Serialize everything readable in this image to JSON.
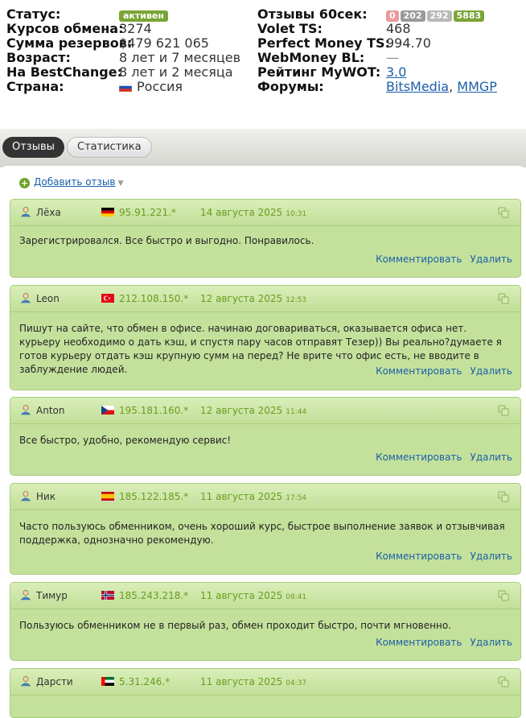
{
  "info": {
    "status_label": "Статус:",
    "status_value": "активен",
    "rates_label": "Курсов обмена:",
    "rates_value": "3274",
    "reserve_label": "Сумма резервов:",
    "reserve_value": "$479 621 065",
    "age_label": "Возраст:",
    "age_value": "8 лет и 7 месяцев",
    "bestchange_label": "На BestChange:",
    "bestchange_value": "8 лет и 2 месяца",
    "country_label": "Страна:",
    "country_value": "Россия",
    "reviews60_label": "Отзывы 60сек:",
    "reviews60_counts": [
      "0",
      "202",
      "292",
      "5883"
    ],
    "volet_label": "Volet TS:",
    "volet_value": "468",
    "pm_label": "Perfect Money TS:",
    "pm_value": "994.70",
    "wm_label": "WebMoney BL:",
    "wm_value": "—",
    "mywot_label": "Рейтинг MyWOT:",
    "mywot_value": "3.0",
    "forums_label": "Форумы:",
    "forum1": "BitsMedia",
    "forum_sep": ",",
    "forum2": "MMGP"
  },
  "colors": {
    "count0": "#e89a9a",
    "count1": "#9a9a9a",
    "count2": "#b8b8b8",
    "count3": "#7aa536"
  },
  "tabs": {
    "reviews": "Отзывы",
    "stats": "Статистика"
  },
  "add_review": "Добавить отзыв",
  "actions": {
    "comment": "Комментировать",
    "delete": "Удалить"
  },
  "reviews": [
    {
      "name": "Лёха",
      "flag": "de",
      "ip": "95.91.221.*",
      "date": "14 августа 2025",
      "time": "10:31",
      "text": "Зарегистрировался. Все быстро и выгодно. Понравилось."
    },
    {
      "name": "Leon",
      "flag": "tr",
      "ip": "212.108.150.*",
      "date": "12 августа 2025",
      "time": "12:53",
      "text": "Пишут на сайте, что обмен в офисе. начинаю договариваться, оказывается офиса нет. курьеру необходимо о дать кэш, и спустя пару часов отправят Тезер)) Вы реально?думаете я готов курьеру отдать кэш крупную сумм на перед? Не врите что офис есть, не вводите в заблуждение людей."
    },
    {
      "name": "Anton",
      "flag": "cz",
      "ip": "195.181.160.*",
      "date": "12 августа 2025",
      "time": "11:44",
      "text": "Все быстро, удобно, рекомендую сервис!"
    },
    {
      "name": "Ник",
      "flag": "es",
      "ip": "185.122.185.*",
      "date": "11 августа 2025",
      "time": "17:54",
      "text": "Часто пользуюсь обменником, очень хороший курс, быстрое выполнение заявок и отзывчивая поддержка, однозначно рекомендую."
    },
    {
      "name": "Тимур",
      "flag": "no",
      "ip": "185.243.218.*",
      "date": "11 августа 2025",
      "time": "08:41",
      "text": "Пользуюсь обменником не в первый раз, обмен проходит быстро, почти мгновенно."
    },
    {
      "name": "Дарсти",
      "flag": "ae",
      "ip": "5.31.246.*",
      "date": "11 августа 2025",
      "time": "04:37",
      "text": ""
    }
  ]
}
